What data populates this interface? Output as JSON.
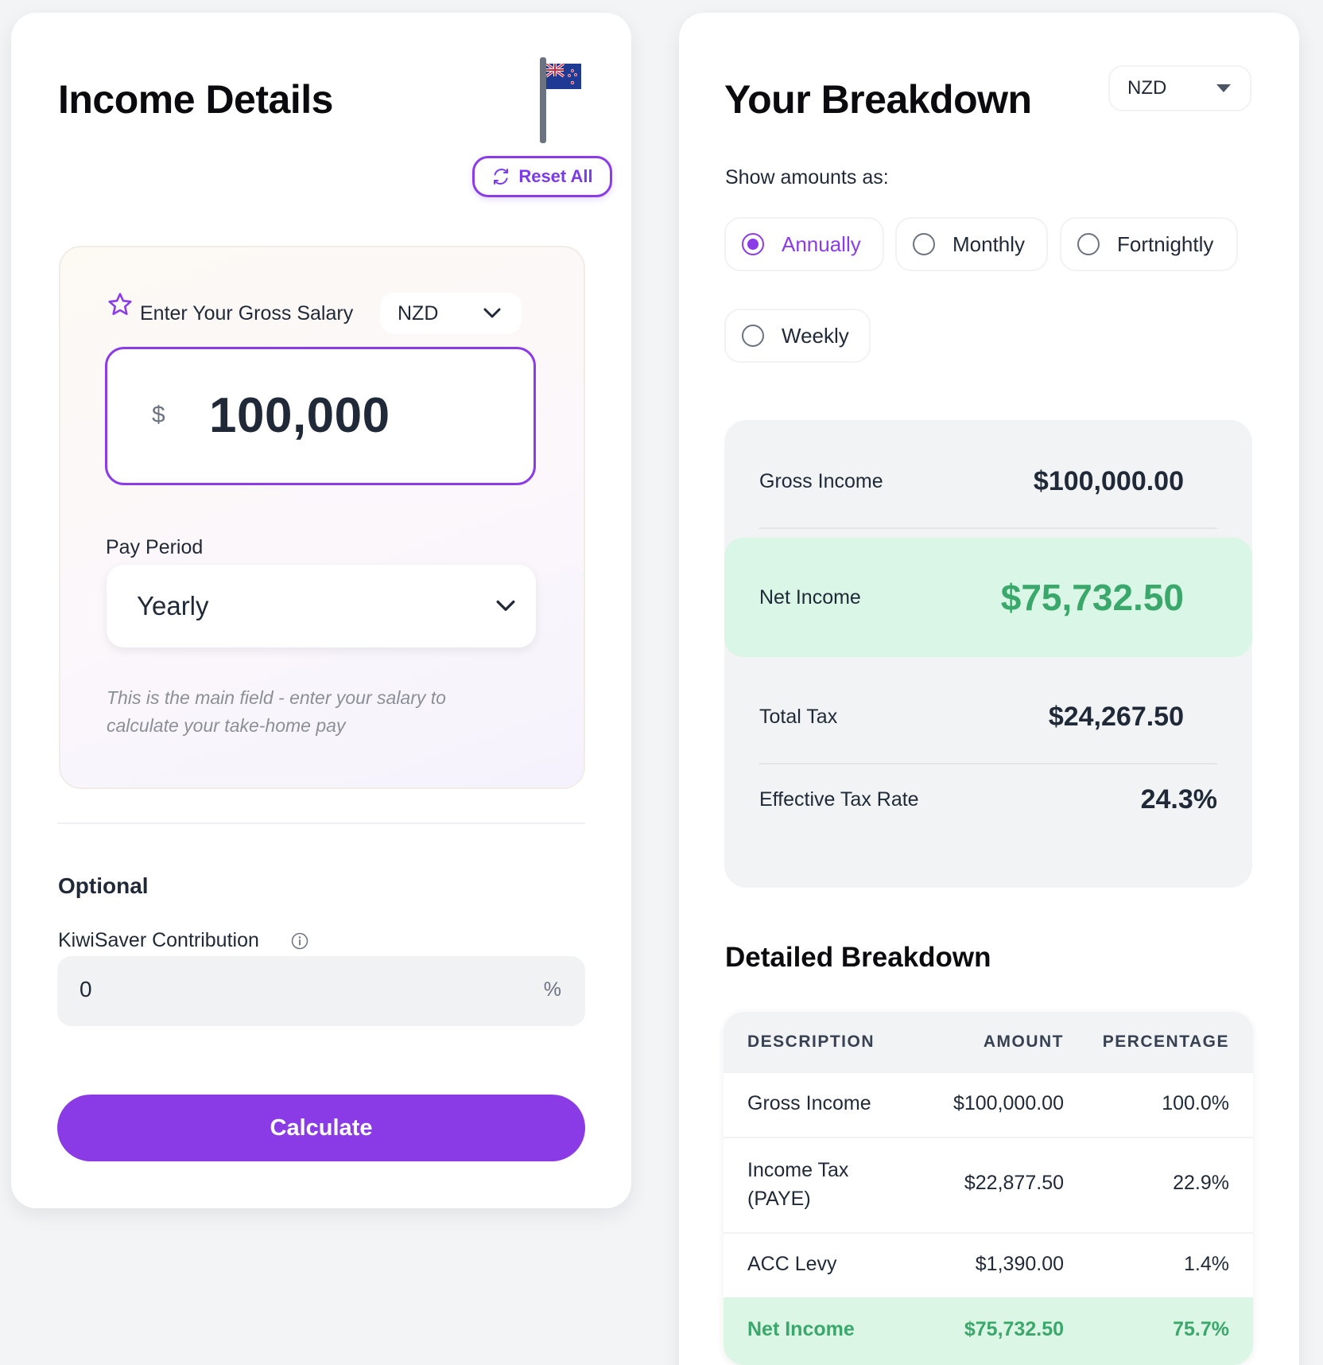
{
  "left": {
    "title": "Income Details",
    "reset_label": "Reset All",
    "salary_label": "Enter Your Gross Salary",
    "currency": "NZD",
    "currency_symbol": "$",
    "salary_value": "100,000",
    "pay_period_label": "Pay Period",
    "pay_period_value": "Yearly",
    "hint": "This is the main field - enter your salary to calculate your take-home pay",
    "optional_title": "Optional",
    "kiwisaver_label": "KiwiSaver Contribution",
    "kiwisaver_value": "0",
    "kiwisaver_unit": "%",
    "calculate_label": "Calculate"
  },
  "right": {
    "title": "Your Breakdown",
    "currency": "NZD",
    "show_label": "Show amounts as:",
    "periods": [
      {
        "label": "Annually",
        "selected": true
      },
      {
        "label": "Monthly",
        "selected": false
      },
      {
        "label": "Fortnightly",
        "selected": false
      },
      {
        "label": "Weekly",
        "selected": false
      }
    ],
    "summary": {
      "gross_label": "Gross Income",
      "gross_value": "$100,000.00",
      "net_label": "Net Income",
      "net_value": "$75,732.50",
      "tax_label": "Total Tax",
      "tax_value": "$24,267.50",
      "rate_label": "Effective Tax Rate",
      "rate_value": "24.3%"
    },
    "detail_title": "Detailed Breakdown",
    "table": {
      "headers": [
        "DESCRIPTION",
        "AMOUNT",
        "PERCENTAGE"
      ],
      "rows": [
        {
          "description": "Gross Income",
          "amount": "$100,000.00",
          "percentage": "100.0%"
        },
        {
          "description": "Income Tax (PAYE)",
          "amount": "$22,877.50",
          "percentage": "22.9%"
        },
        {
          "description": "ACC Levy",
          "amount": "$1,390.00",
          "percentage": "1.4%"
        },
        {
          "description": "Net Income",
          "amount": "$75,732.50",
          "percentage": "75.7%"
        }
      ]
    }
  },
  "colors": {
    "accent": "#8b3ce8",
    "positive": "#3aa86b",
    "positive_bg": "#d9f6e6"
  }
}
